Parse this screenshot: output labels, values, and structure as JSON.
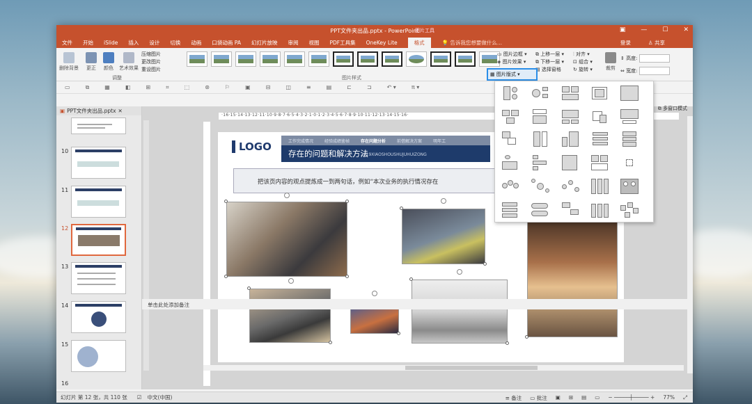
{
  "window": {
    "title": "PPT文件夹出品.pptx - PowerPoint",
    "picture_tools": "图片工具"
  },
  "menu": {
    "items": [
      "文件",
      "开始",
      "iSlide",
      "插入",
      "设计",
      "切换",
      "动画",
      "口袋动画 PA",
      "幻灯片放映",
      "审阅",
      "视图",
      "PDF工具集",
      "OneKey Lite"
    ],
    "active": "格式",
    "tell": "告诉我您想要做什么...",
    "login": "登录",
    "share": "共享"
  },
  "ribbon": {
    "remove_bg": "删除背景",
    "correct": "更正",
    "color": "颜色",
    "artistic": "艺术效果",
    "compress": "压缩图片",
    "change": "更改图片",
    "reset": "重设图片",
    "group_adjust": "调整",
    "group_styles": "图片样式",
    "border": "图片边框",
    "effects": "图片效果",
    "layout": "图片版式",
    "bring_forward": "上移一层",
    "send_backward": "下移一层",
    "selection_pane": "选择窗格",
    "align": "对齐",
    "group": "组合",
    "rotate": "旋转",
    "crop": "裁剪",
    "height": "高度:",
    "width": "宽度:"
  },
  "thumbs": {
    "tab": "PPT文件夹出品.pptx",
    "numbers": [
      "10",
      "11",
      "12",
      "13",
      "14",
      "15",
      "16"
    ]
  },
  "ruler": "·16·15·14·13·12·11·10·9·8·7·6·5·4·3·2·1·0·1·2·3·4·5·6·7·8·9·10·11·12·13·14·15·16·",
  "slide": {
    "logo": "LOGO",
    "tabs": [
      "工作完成情况",
      "经验成绩鉴帧",
      "存在问题分析",
      "前借解决方案",
      "明年工"
    ],
    "active_tab": "存在问题分析",
    "title": "存在的问题和解决方法",
    "subtitle": "2019XIAOSHOUSHUJUHUIZONG",
    "quote": "把该页内容的观点提炼成一到两句话，例如“本次业务的执行情况存在"
  },
  "view": {
    "multi": "多窗口模式"
  },
  "notes": "单击此处添加备注",
  "status": {
    "slide": "幻灯片 第 12 张，共 110 张",
    "lang": "中文(中国)",
    "notes": "备注",
    "comments": "批注",
    "zoom": "77%"
  }
}
